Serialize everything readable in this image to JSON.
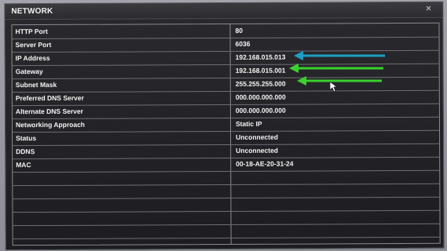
{
  "window": {
    "title": "NETWORK",
    "close_glyph": "×"
  },
  "rows": [
    {
      "label": "HTTP Port",
      "value": "80"
    },
    {
      "label": "Server Port",
      "value": "6036"
    },
    {
      "label": "IP Address",
      "value": "192.168.015.013"
    },
    {
      "label": "Gateway",
      "value": "192.168.015.001"
    },
    {
      "label": "Subnet Mask",
      "value": "255.255.255.000"
    },
    {
      "label": "Preferred DNS Server",
      "value": "000.000.000.000"
    },
    {
      "label": "Alternate DNS Server",
      "value": "000.000.000.000"
    },
    {
      "label": "Networking Approach",
      "value": "Static IP"
    },
    {
      "label": "Status",
      "value": "Unconnected"
    },
    {
      "label": "DDNS",
      "value": "Unconnected"
    },
    {
      "label": "MAC",
      "value": "00-18-AE-20-31-24"
    },
    {
      "label": "",
      "value": ""
    },
    {
      "label": "",
      "value": ""
    },
    {
      "label": "",
      "value": ""
    },
    {
      "label": "",
      "value": ""
    },
    {
      "label": "",
      "value": ""
    }
  ],
  "annotations": {
    "ip_arrow_color": "#1e9ec2",
    "gateway_arrow_color": "#39d12e",
    "subnet_arrow_color": "#39d12e"
  }
}
